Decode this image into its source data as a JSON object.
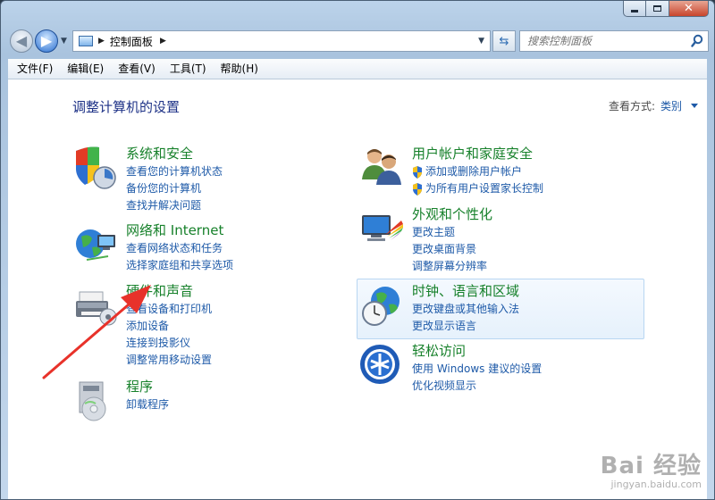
{
  "window": {
    "controls": {
      "minimize": "minimize-icon",
      "maximize": "maximize-icon",
      "close": "close-icon"
    }
  },
  "nav": {
    "address_path": "控制面板",
    "search_placeholder": "搜索控制面板"
  },
  "menu": [
    "文件(F)",
    "编辑(E)",
    "查看(V)",
    "工具(T)",
    "帮助(H)"
  ],
  "page": {
    "title": "调整计算机的设置",
    "view_by_label": "查看方式:",
    "view_by_value": "类别"
  },
  "categories": {
    "system": {
      "title": "系统和安全",
      "links": [
        "查看您的计算机状态",
        "备份您的计算机",
        "查找并解决问题"
      ]
    },
    "network": {
      "title": "网络和 Internet",
      "links": [
        "查看网络状态和任务",
        "选择家庭组和共享选项"
      ]
    },
    "hardware": {
      "title": "硬件和声音",
      "links": [
        "查看设备和打印机",
        "添加设备",
        "连接到投影仪",
        "调整常用移动设置"
      ]
    },
    "programs": {
      "title": "程序",
      "links": [
        "卸载程序"
      ]
    },
    "users": {
      "title": "用户帐户和家庭安全",
      "links": [
        "添加或删除用户帐户",
        "为所有用户设置家长控制"
      ]
    },
    "appearance": {
      "title": "外观和个性化",
      "links": [
        "更改主题",
        "更改桌面背景",
        "调整屏幕分辨率"
      ]
    },
    "clock": {
      "title": "时钟、语言和区域",
      "links": [
        "更改键盘或其他输入法",
        "更改显示语言"
      ]
    },
    "ease": {
      "title": "轻松访问",
      "links": [
        "使用 Windows 建议的设置",
        "优化视频显示"
      ]
    }
  },
  "colors": {
    "category_title": "#17812b",
    "link": "#1e5aa8",
    "annotation": "#e8322a"
  },
  "watermark": {
    "main": "Bai 经验",
    "sub": "jingyan.baidu.com"
  }
}
